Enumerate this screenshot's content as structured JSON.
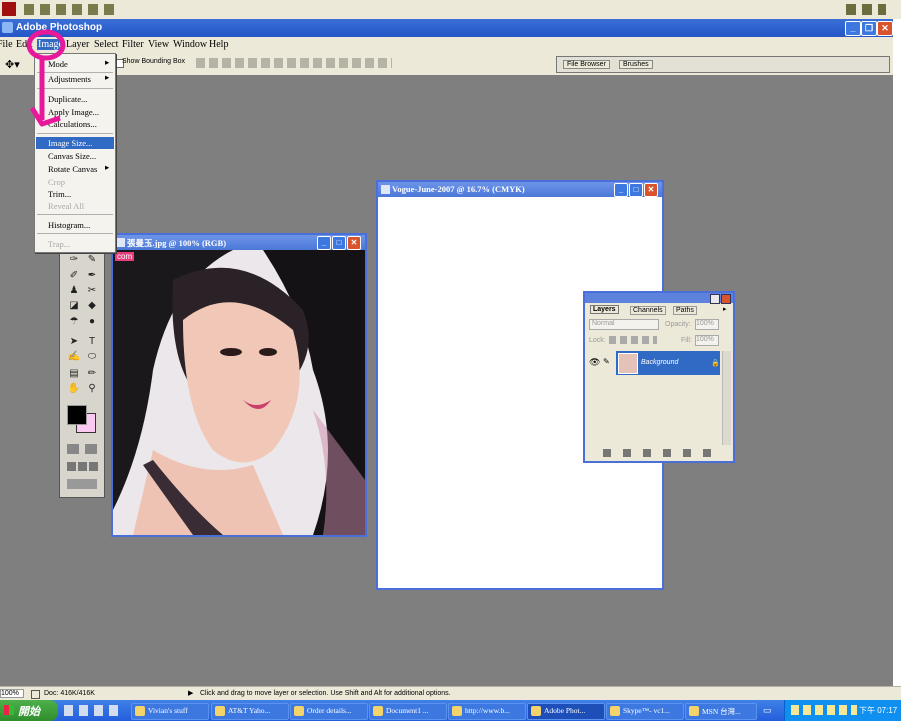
{
  "app": {
    "title": "Adobe Photoshop",
    "menu": [
      "File",
      "Edit",
      "Image",
      "Layer",
      "Select",
      "Filter",
      "View",
      "Window",
      "Help"
    ],
    "options_bar": {
      "show_bounding_box": "Show Bounding Box"
    },
    "palette_tabs": [
      "File Browser",
      "Brushes"
    ]
  },
  "image_menu": {
    "items": [
      {
        "label": "Mode",
        "submenu": true,
        "enabled": true
      },
      {
        "label": "Adjustments",
        "submenu": true,
        "enabled": true
      },
      {
        "label": "Duplicate...",
        "enabled": true
      },
      {
        "label": "Apply Image...",
        "enabled": true
      },
      {
        "label": "Calculations...",
        "enabled": true
      },
      {
        "label": "Image Size...",
        "enabled": true,
        "selected": true
      },
      {
        "label": "Canvas Size...",
        "enabled": true
      },
      {
        "label": "Rotate Canvas",
        "submenu": true,
        "enabled": true
      },
      {
        "label": "Crop",
        "enabled": false
      },
      {
        "label": "Trim...",
        "enabled": true
      },
      {
        "label": "Reveal All",
        "enabled": false
      },
      {
        "label": "Histogram...",
        "enabled": true
      },
      {
        "label": "Trap...",
        "enabled": false
      }
    ]
  },
  "doc_photo": {
    "title": "張曼玉.jpg @ 100% (RGB)",
    "watermark": "com"
  },
  "doc_blank": {
    "title": "Vogue-June-2007 @ 16.7% (CMYK)"
  },
  "layers_panel": {
    "tabs": [
      "Layers",
      "Channels",
      "Paths"
    ],
    "blend_mode": "Normal",
    "opacity_label": "Opacity:",
    "opacity": "100%",
    "lock_label": "Lock:",
    "fill_label": "Fill:",
    "fill": "100%",
    "layer_name": "Background"
  },
  "status": {
    "zoom": "100%",
    "doc": "Doc: 416K/416K",
    "hint": "Click and drag to move layer or selection.  Use Shift and Alt for additional options."
  },
  "taskbar": {
    "start": "開始",
    "tasks": [
      "Vivian's stuff",
      "AT&T Yaho...",
      "Order details...",
      "Document1 ...",
      "http://www.b...",
      "Adobe Phot...",
      "Skype™- vc1...",
      "MSN 台灣..."
    ],
    "clock": "下午 07:17"
  },
  "colors": {
    "annotation": "#e8189a",
    "xp_blue": "#245edb",
    "workspace": "#807f7f"
  }
}
